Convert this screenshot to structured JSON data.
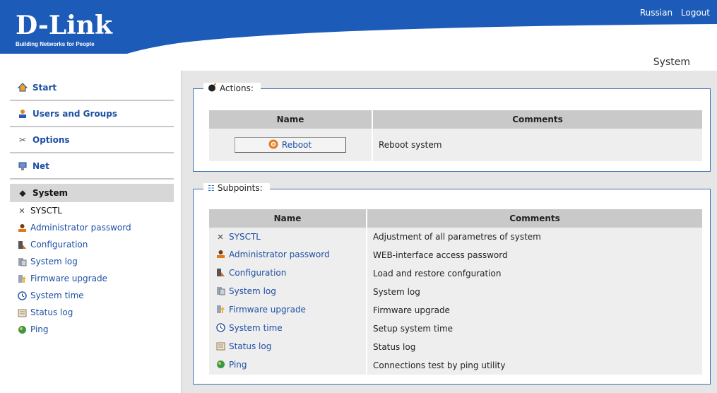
{
  "header": {
    "logo": "D-Link",
    "slogan": "Building Networks for People",
    "links": [
      "Russian",
      "Logout"
    ],
    "brand_color": "#1d5bb8"
  },
  "page_title": "System",
  "sidebar": {
    "items": [
      {
        "label": "Start",
        "icon": "home-icon"
      },
      {
        "label": "Users and Groups",
        "icon": "user-icon"
      },
      {
        "label": "Options",
        "icon": "tools-icon"
      },
      {
        "label": "Net",
        "icon": "network-icon"
      },
      {
        "label": "System",
        "icon": "system-icon",
        "active": true
      }
    ],
    "subitems": [
      {
        "label": "SYSCTL",
        "icon": "tools-icon",
        "current": true
      },
      {
        "label": "Administrator password",
        "icon": "admin-icon"
      },
      {
        "label": "Configuration",
        "icon": "configuration-icon"
      },
      {
        "label": "System log",
        "icon": "log-icon"
      },
      {
        "label": "Firmware upgrade",
        "icon": "upgrade-icon"
      },
      {
        "label": "System time",
        "icon": "clock-icon"
      },
      {
        "label": "Status log",
        "icon": "status-log-icon"
      },
      {
        "label": "Ping",
        "icon": "ping-icon"
      }
    ]
  },
  "actions": {
    "legend": "Actions:",
    "headers": [
      "Name",
      "Comments"
    ],
    "rows": [
      {
        "button": "Reboot",
        "comment": "Reboot system"
      }
    ]
  },
  "subpoints": {
    "legend": "Subpoints:",
    "headers": [
      "Name",
      "Comments"
    ],
    "rows": [
      {
        "name": "SYSCTL",
        "comment": "Adjustment of all parametres of system"
      },
      {
        "name": "Administrator password",
        "comment": "WEB-interface access password"
      },
      {
        "name": "Configuration",
        "comment": "Load and restore confguration"
      },
      {
        "name": "System log",
        "comment": "System log"
      },
      {
        "name": "Firmware upgrade",
        "comment": "Firmware upgrade"
      },
      {
        "name": "System time",
        "comment": "Setup system time"
      },
      {
        "name": "Status log",
        "comment": "Status log"
      },
      {
        "name": "Ping",
        "comment": "Connections test by ping utility"
      }
    ]
  }
}
